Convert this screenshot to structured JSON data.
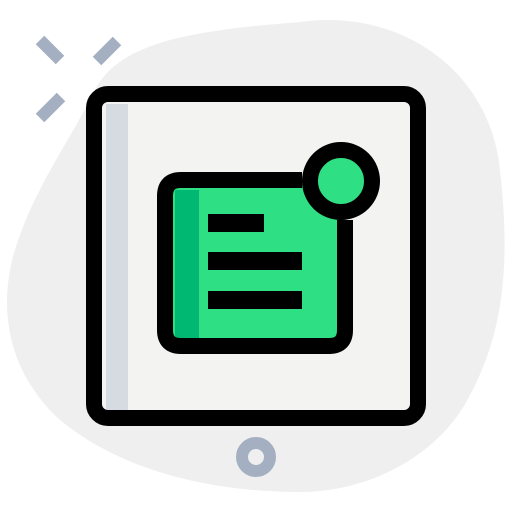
{
  "icon": {
    "name": "tablet-notification-icon",
    "description_hidden": "",
    "colors": {
      "background_blob": "#efefef",
      "sparkle": "#a4afc1",
      "tablet_body": "#f3f3f1",
      "tablet_shade": "#d5dbe1",
      "outline": "#000000",
      "card_fill": "#2fdf84",
      "card_shade": "#00b871",
      "home_button": "#a4afc1"
    }
  }
}
